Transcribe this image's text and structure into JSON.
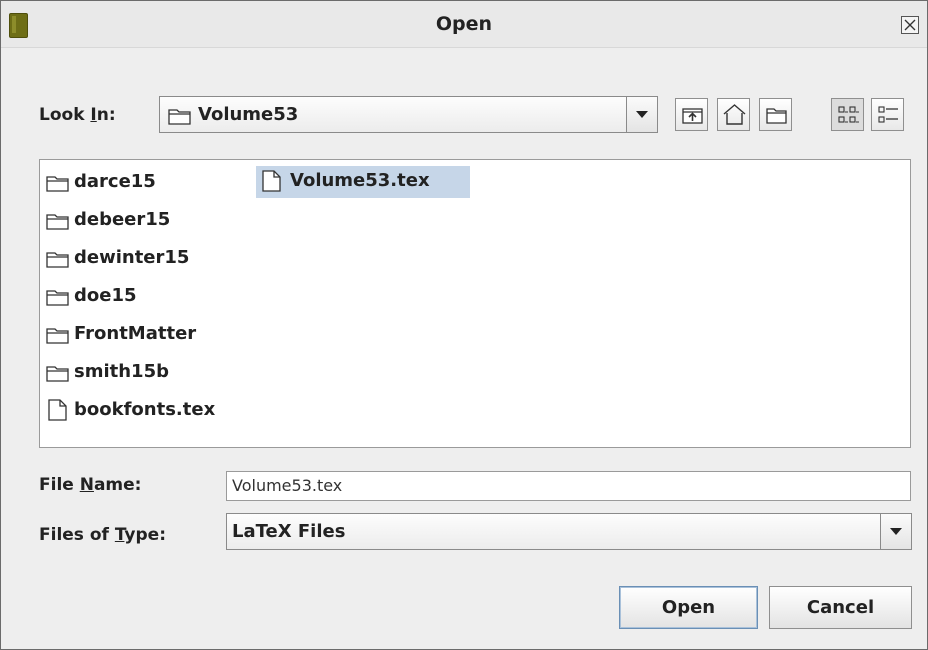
{
  "window": {
    "title": "Open",
    "app_icon": "book-icon",
    "close_icon": "close-icon"
  },
  "look_in": {
    "label_prefix": "Look ",
    "label_mnemonic": "I",
    "label_suffix": "n:",
    "value": "Volume53",
    "value_icon": "folder-icon"
  },
  "toolbar": {
    "up_icon": "up-one-level-icon",
    "home_icon": "home-icon",
    "new_folder_icon": "new-folder-icon",
    "list_view_icon": "list-view-icon",
    "details_view_icon": "details-view-icon"
  },
  "files": {
    "column1": [
      {
        "name": "darce15",
        "type": "folder"
      },
      {
        "name": "debeer15",
        "type": "folder"
      },
      {
        "name": "dewinter15",
        "type": "folder"
      },
      {
        "name": "doe15",
        "type": "folder"
      },
      {
        "name": "FrontMatter",
        "type": "folder"
      },
      {
        "name": "smith15b",
        "type": "folder"
      },
      {
        "name": "bookfonts.tex",
        "type": "file"
      }
    ],
    "column2": [
      {
        "name": "Volume53.tex",
        "type": "file",
        "selected": true
      }
    ]
  },
  "file_name": {
    "label_prefix": "File ",
    "label_mnemonic": "N",
    "label_suffix": "ame:",
    "value": "Volume53.tex"
  },
  "file_type": {
    "label_prefix": "Files of ",
    "label_mnemonic": "T",
    "label_suffix": "ype:",
    "value": "LaTeX Files"
  },
  "buttons": {
    "open": "Open",
    "cancel": "Cancel"
  },
  "colors": {
    "selection": "#c6d6e8",
    "window_bg": "#eeeeee"
  }
}
